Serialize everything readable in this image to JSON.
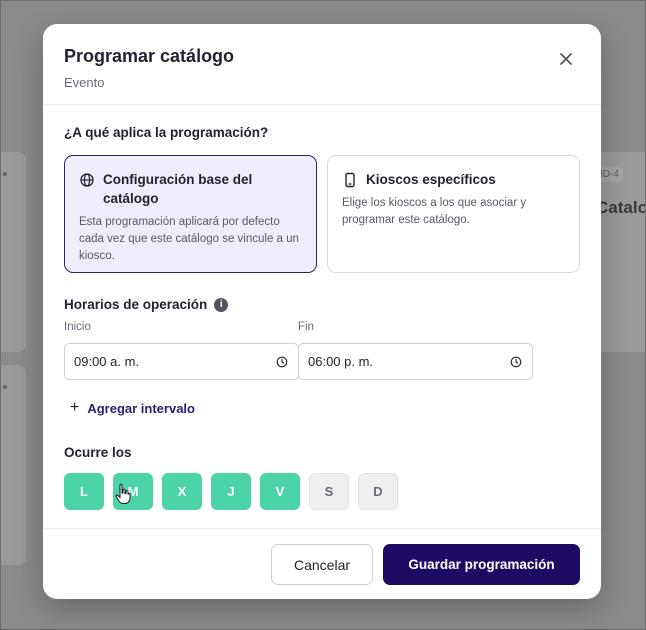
{
  "background": {
    "tag": "ID-4",
    "title": "Catalo"
  },
  "modal": {
    "title": "Programar catálogo",
    "subtitle": "Evento",
    "close_icon": "close-icon"
  },
  "apply": {
    "question": "¿A qué aplica la programación?",
    "options": [
      {
        "icon": "globe-icon",
        "title": "Configuración base del catálogo",
        "description": "Esta programación aplicará por defecto cada vez que este catálogo se vincule a un kiosco.",
        "selected": true
      },
      {
        "icon": "kiosk-icon",
        "title": "Kioscos específicos",
        "description": "Elige los kioscos a los que asociar y programar este catálogo.",
        "selected": false
      }
    ]
  },
  "schedule": {
    "label": "Horarios de operación",
    "info_icon": "i",
    "start_label": "Inicio",
    "start_value": "09:00 a. m.",
    "end_label": "Fin",
    "end_value": "06:00 p. m.",
    "add_interval": "Agregar intervalo",
    "add_icon": "+"
  },
  "days": {
    "label": "Ocurre los",
    "items": [
      {
        "label": "L",
        "active": true
      },
      {
        "label": "M",
        "active": true
      },
      {
        "label": "X",
        "active": true
      },
      {
        "label": "J",
        "active": true
      },
      {
        "label": "V",
        "active": true
      },
      {
        "label": "S",
        "active": false
      },
      {
        "label": "D",
        "active": false
      }
    ]
  },
  "footer": {
    "cancel": "Cancelar",
    "save": "Guardar programación"
  },
  "colors": {
    "primary": "#1e0b63",
    "day_active": "#4cd3a8",
    "selected_bg": "#eeedf9"
  }
}
